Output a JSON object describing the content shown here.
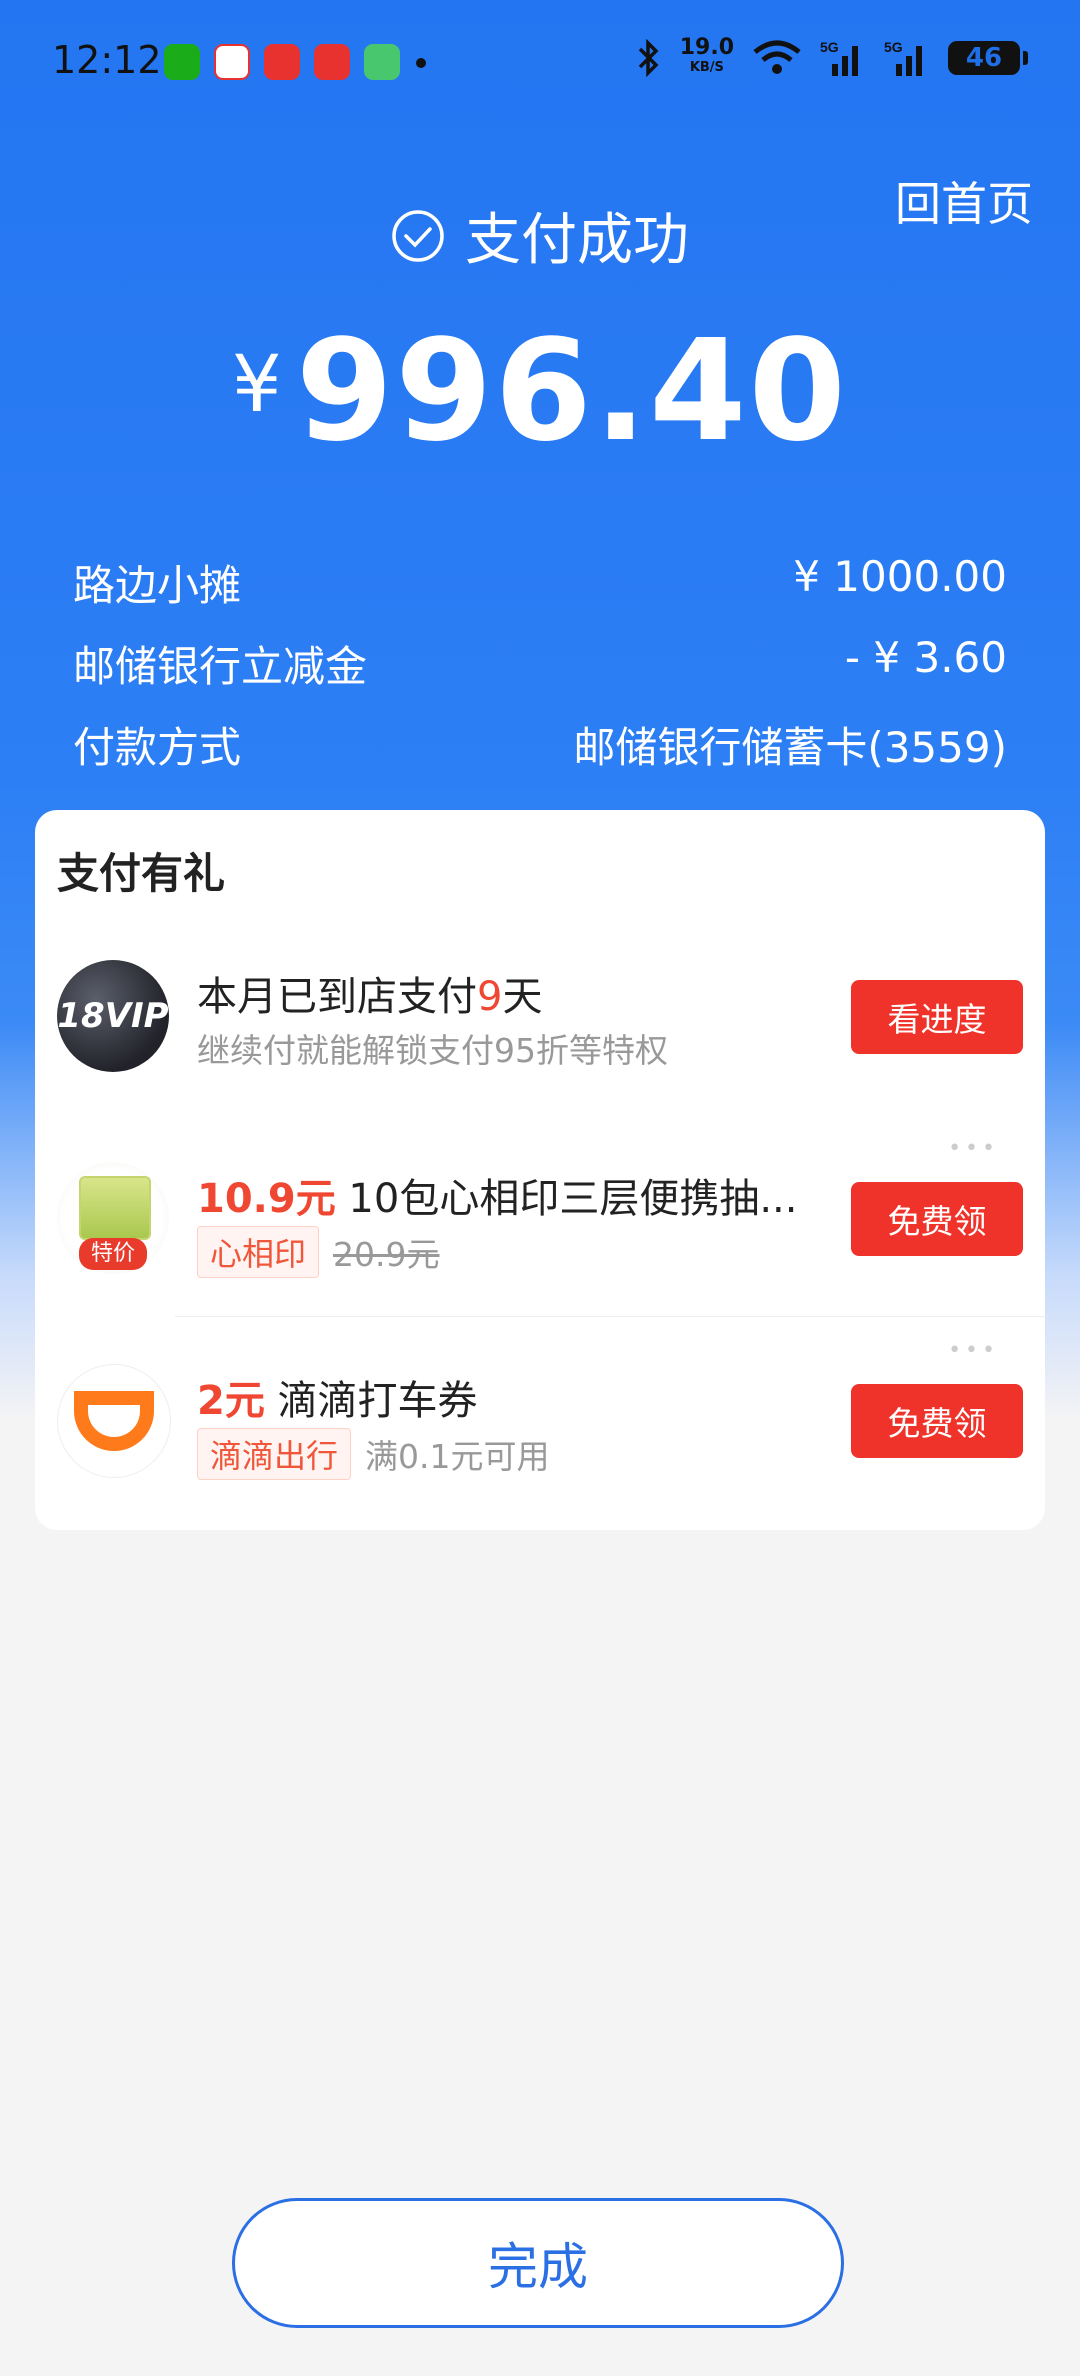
{
  "status_bar": {
    "time": "12:12",
    "net_speed": "19.0",
    "net_unit": "KB/S",
    "battery": "46",
    "app_icons": [
      "wechat-icon",
      "alipay-icon",
      "yunshanfu-icon",
      "wangshangyinhang-icon",
      "green-app-icon"
    ],
    "colors": [
      "#1aad19",
      "#e8322f",
      "#e8322f",
      "#e8322f",
      "#49c76e"
    ]
  },
  "header": {
    "home_link": "回首页",
    "success_text": "支付成功"
  },
  "amount": {
    "currency": "¥",
    "value": "996.40"
  },
  "details": [
    {
      "label": "路边小摊",
      "value": "¥ 1000.00"
    },
    {
      "label": "邮储银行立减金",
      "value": "- ¥ 3.60"
    },
    {
      "label": "付款方式",
      "value": "邮储银行储蓄卡(3559)"
    }
  ],
  "rewards": {
    "title": "支付有礼",
    "items": [
      {
        "icon_text": "18VIP",
        "title_prefix": "本月已到店支付",
        "title_highlight": "9",
        "title_suffix": "天",
        "subtitle": "继续付就能解锁支付95折等特权",
        "button": "看进度"
      },
      {
        "icon_tag": "特价",
        "price": "10.9元",
        "title": "10包心相印三层便携抽...",
        "chip": "心相印",
        "old_price": "20.9元",
        "button": "免费领"
      },
      {
        "price": "2元",
        "title": "滴滴打车券",
        "chip": "滴滴出行",
        "condition": "满0.1元可用",
        "button": "免费领"
      }
    ]
  },
  "footer": {
    "done_button": "完成"
  },
  "theme": {
    "primary_blue": "#2475f1",
    "accent_red": "#f0332a"
  }
}
